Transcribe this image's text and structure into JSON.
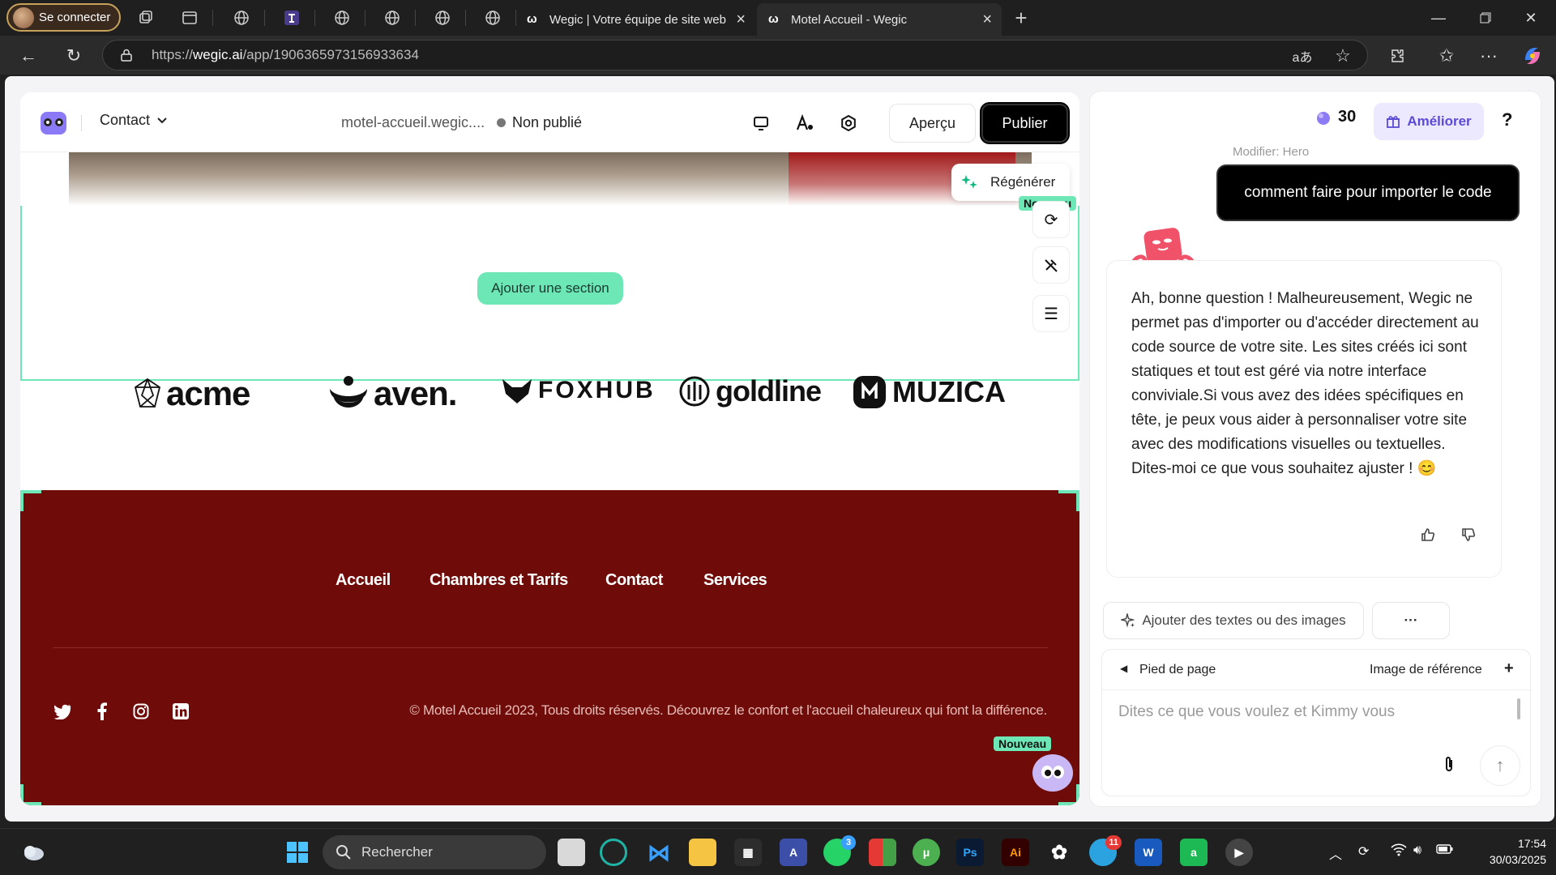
{
  "browser": {
    "profile_label": "Se connecter",
    "tabs": [
      {
        "title": "Wegic | Votre équipe de site web"
      },
      {
        "title": "Motel Accueil - Wegic"
      }
    ],
    "url_prefix": "https://",
    "url_domain": "wegic.ai",
    "url_path": "/app/1906365973156933634"
  },
  "editor": {
    "page_selector": "Contact",
    "domain": "motel-accueil.wegic....",
    "publish_status": "Non publié",
    "preview_label": "Aperçu",
    "publish_label": "Publier",
    "regenerate_label": "Régénérer",
    "new_badge": "Nouveau",
    "add_section_label": "Ajouter une section",
    "logos": [
      "acme",
      "aven.",
      "FOXHUB",
      "goldline",
      "MUZICA"
    ],
    "footer": {
      "nav": [
        "Accueil",
        "Chambres et Tarifs",
        "Contact",
        "Services"
      ],
      "copyright": "© Motel Accueil 2023, Tous droits réservés. Découvrez le confort et l'accueil chaleureux qui font la différence.",
      "social_icons": [
        "twitter-icon",
        "facebook-icon",
        "instagram-icon",
        "linkedin-icon"
      ],
      "bg_color": "#6f0b08"
    },
    "accent_color": "#6ee7b7"
  },
  "chat": {
    "credits": "30",
    "upgrade_label": "Améliorer",
    "help_label": "?",
    "faded_label": "Modifier: Hero",
    "user_message": "comment faire pour importer le code",
    "bot_message": "Ah, bonne question ! Malheureusement, Wegic ne permet pas d'importer ou d'accéder directement au code source de votre site. Les sites créés ici sont statiques et tout est géré via notre interface conviviale.Si vous avez des idées spécifiques en tête, je peux vous aider à personnaliser votre site avec des modifications visuelles ou textuelles. Dites-moi ce que vous souhaitez ajuster ! 😊",
    "suggestion_chip": "Ajouter des textes ou des images",
    "more_label": "···",
    "context_section": "Pied de page",
    "reference_image_label": "Image de référence",
    "input_placeholder": "Dites ce que vous voulez et Kimmy vous"
  },
  "taskbar": {
    "search_placeholder": "Rechercher",
    "time": "17:54",
    "date": "30/03/2025",
    "whatsapp_badge": "3",
    "telegram_badge": "11"
  }
}
